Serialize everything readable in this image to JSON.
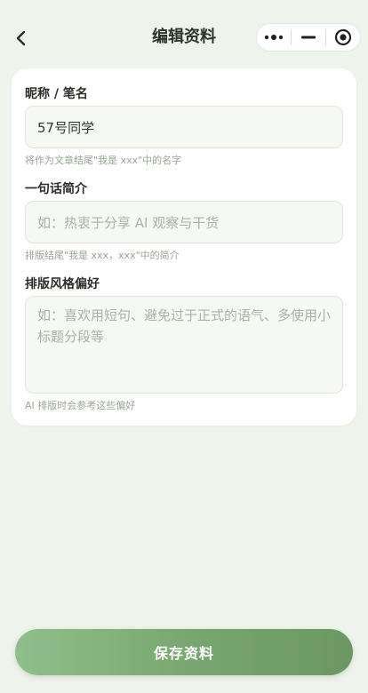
{
  "header": {
    "title": "编辑资料",
    "back_icon": "chevron-left-icon",
    "capsule": {
      "more_icon": "more-dots-icon",
      "minimize_icon": "minimize-icon",
      "close_icon": "target-close-icon"
    }
  },
  "form": {
    "nickname": {
      "label": "昵称 / 笔名",
      "value": "57号同学",
      "hint": "将作为文章结尾\"我是 xxx\"中的名字"
    },
    "bio": {
      "label": "一句话简介",
      "placeholder": "如：热衷于分享 AI 观察与干货",
      "hint": "排版结尾\"我是 xxx，xxx\"中的简介"
    },
    "style": {
      "label": "排版风格偏好",
      "placeholder": "如：喜欢用短句、避免过于正式的语气、多使用小标题分段等",
      "hint": "AI 排版时会参考这些偏好"
    }
  },
  "actions": {
    "save_label": "保存资料"
  },
  "colors": {
    "background": "#eef3eb",
    "accent_start": "#8fbf8a",
    "accent_end": "#6a9762",
    "hint_text": "#98a596"
  }
}
